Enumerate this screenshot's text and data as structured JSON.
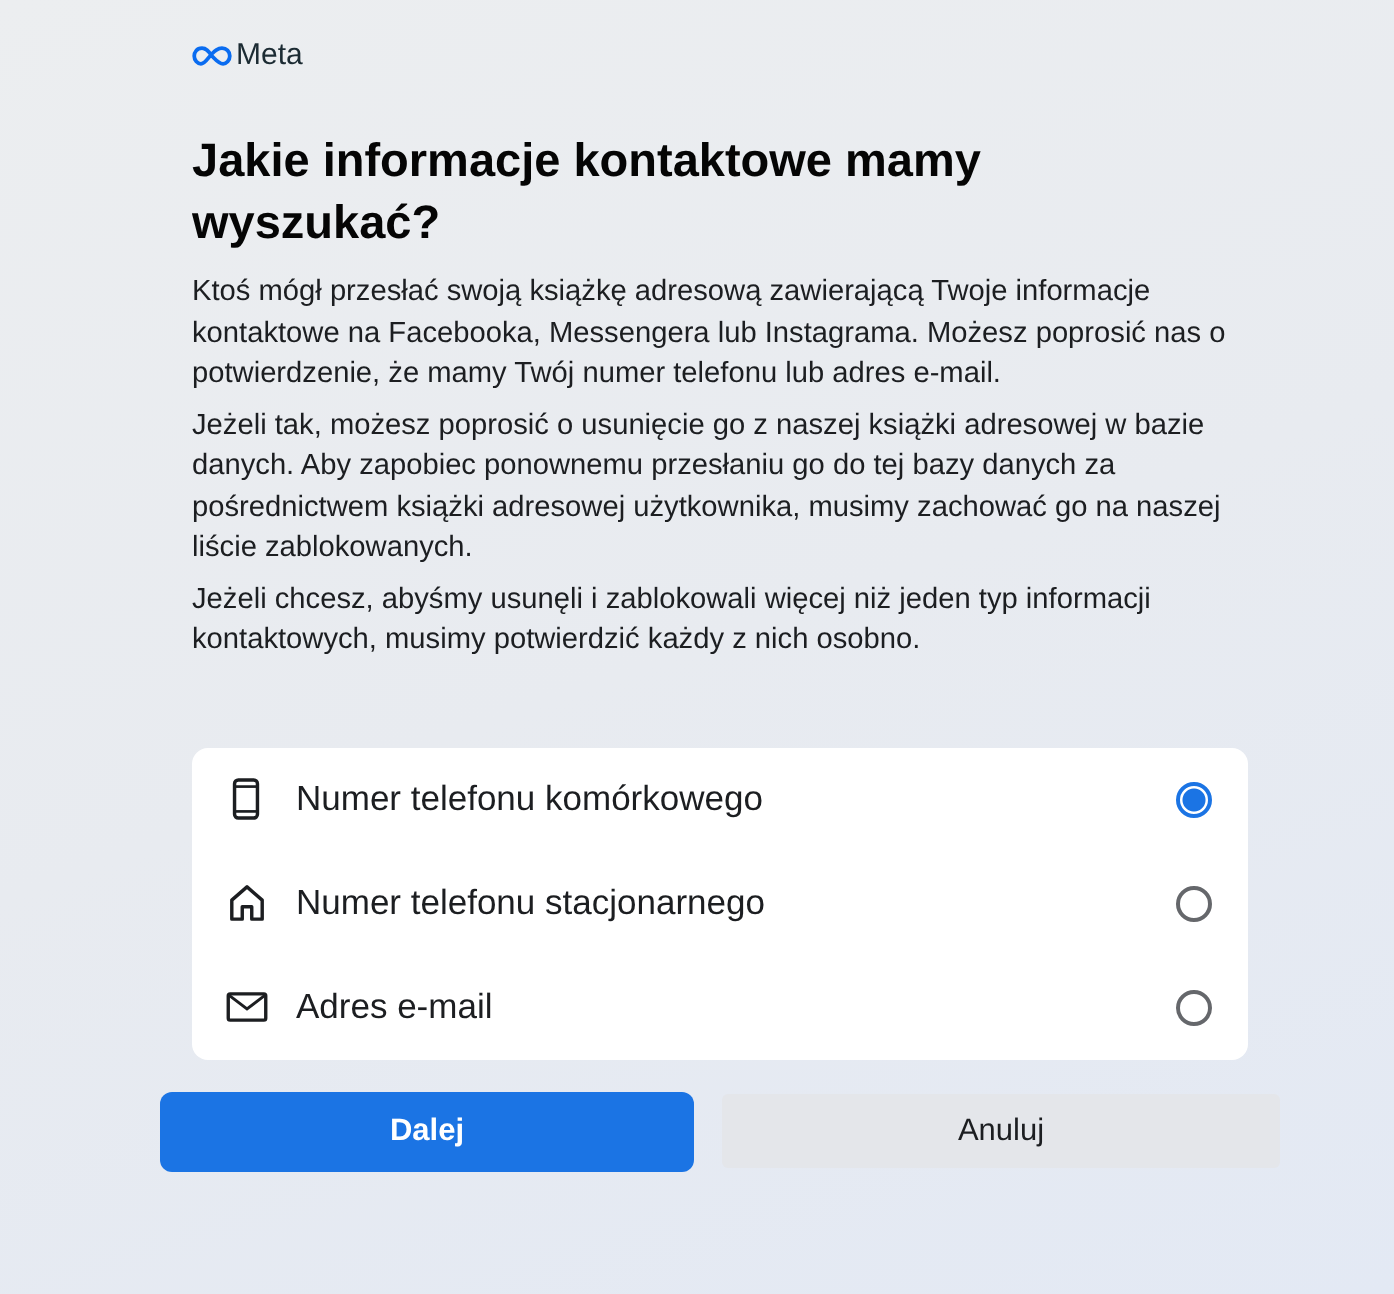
{
  "logo": {
    "text": "Meta"
  },
  "heading": "Jakie informacje kontaktowe mamy wyszukać?",
  "paragraphs": [
    "Ktoś mógł przesłać swoją książkę adresową zawierającą Twoje informacje kontaktowe na Facebooka, Messengera lub Instagrama. Możesz poprosić nas o potwierdzenie, że mamy Twój numer telefonu lub adres e-mail.",
    "Jeżeli tak, możesz poprosić o usunięcie go z naszej książki adresowej w bazie danych. Aby zapobiec ponownemu przesłaniu go do tej bazy danych za pośrednictwem książki adresowej użytkownika, musimy zachować go na naszej liście zablokowanych.",
    "Jeżeli chcesz, abyśmy usunęli i zablokowali więcej niż jeden typ informacji kontaktowych, musimy potwierdzić każdy z nich osobno."
  ],
  "options": [
    {
      "kind": "mobile",
      "label": "Numer telefonu komórkowego",
      "selected": true
    },
    {
      "kind": "landline",
      "label": "Numer telefonu stacjonarnego",
      "selected": false
    },
    {
      "kind": "email",
      "label": "Adres e-mail",
      "selected": false
    }
  ],
  "buttons": [
    {
      "kind": "primary",
      "label": "Dalej"
    },
    {
      "kind": "secondary",
      "label": "Anuluj"
    }
  ]
}
